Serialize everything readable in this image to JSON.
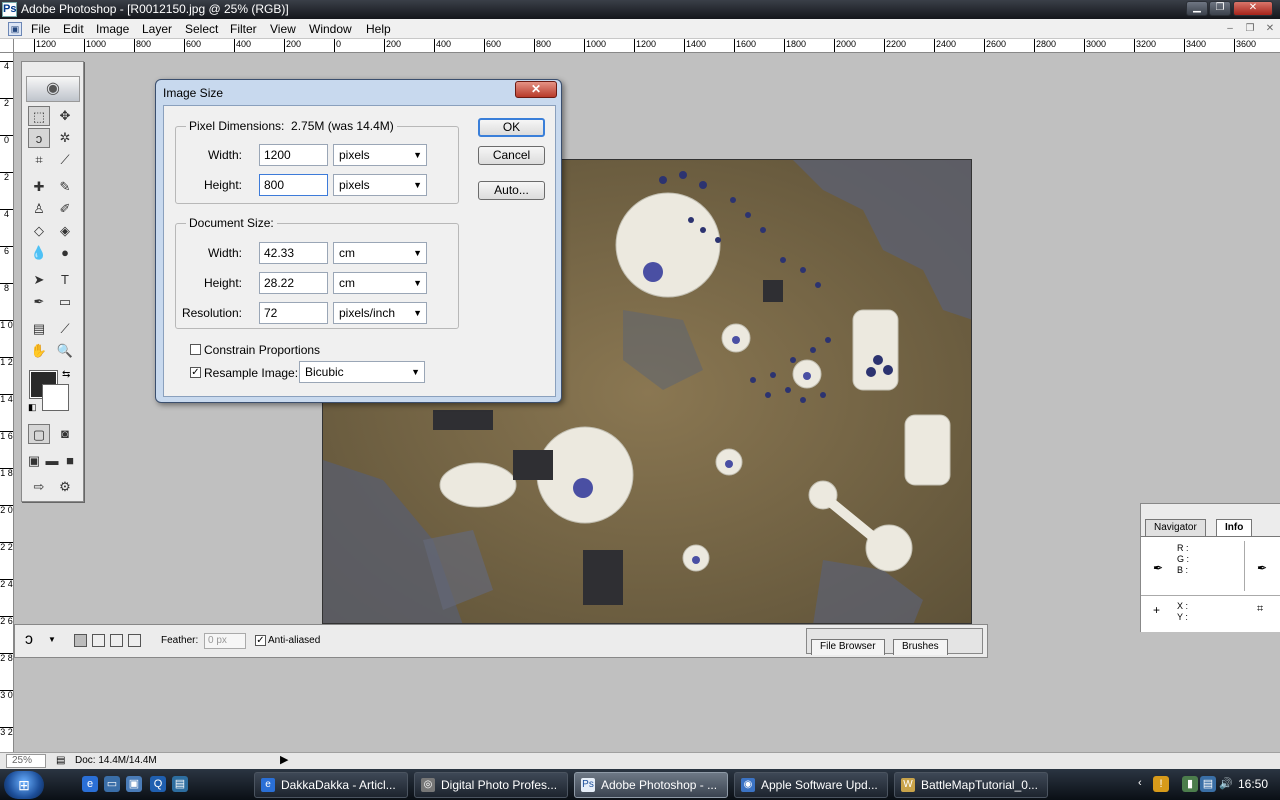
{
  "window": {
    "title": "Adobe Photoshop - [R0012150.jpg @ 25% (RGB)]",
    "controls": [
      "minimize-icon",
      "restore-icon",
      "close-icon"
    ]
  },
  "menu": {
    "items": [
      "File",
      "Edit",
      "Image",
      "Layer",
      "Select",
      "Filter",
      "View",
      "Window",
      "Help"
    ]
  },
  "ruler": {
    "h_ticks": [
      "1200",
      "1000",
      "800",
      "600",
      "400",
      "200",
      "0",
      "200",
      "400",
      "600",
      "800",
      "1000",
      "1200",
      "1400",
      "1600",
      "1800",
      "2000",
      "2200",
      "2400",
      "2600",
      "2800",
      "3000",
      "3200",
      "3400",
      "3600"
    ],
    "v_ticks": [
      "4",
      "2",
      "0",
      "2",
      "4",
      "6",
      "8",
      "1 0",
      "1 2",
      "1 4",
      "1 6",
      "1 8",
      "2 0",
      "2 2",
      "2 4",
      "2 6",
      "2 8",
      "3 0",
      "3 2"
    ]
  },
  "dialog": {
    "title": "Image Size",
    "pixel_dimensions": {
      "label": "Pixel Dimensions:",
      "size": "2.75M (was 14.4M)",
      "width_label": "Width:",
      "width_value": "1200",
      "width_unit": "pixels",
      "height_label": "Height:",
      "height_value": "800",
      "height_unit": "pixels"
    },
    "document_size": {
      "label": "Document Size:",
      "width_label": "Width:",
      "width_value": "42.33",
      "width_unit": "cm",
      "height_label": "Height:",
      "height_value": "28.22",
      "height_unit": "cm",
      "resolution_label": "Resolution:",
      "resolution_value": "72",
      "resolution_unit": "pixels/inch"
    },
    "constrain_proportions": {
      "label": "Constrain Proportions",
      "checked": false
    },
    "resample_image": {
      "label": "Resample Image:",
      "checked": true,
      "method": "Bicubic"
    },
    "buttons": {
      "ok": "OK",
      "cancel": "Cancel",
      "auto": "Auto..."
    }
  },
  "options_bar": {
    "feather_label": "Feather:",
    "feather_value": "0 px",
    "anti_aliased_label": "Anti-aliased",
    "anti_aliased_checked": true,
    "tabs": [
      "File Browser",
      "Brushes"
    ]
  },
  "info_palette": {
    "tabs": [
      "Navigator",
      "Info"
    ],
    "active_tab": "Info",
    "rgb_labels": [
      "R :",
      "G :",
      "B :"
    ],
    "xy_labels": [
      "X :",
      "Y :"
    ]
  },
  "status_bar": {
    "zoom": "25%",
    "doc_info": "Doc: 14.4M/14.4M"
  },
  "taskbar": {
    "buttons": [
      {
        "label": "DakkaDakka - Articl...",
        "icon": "ie-icon",
        "active": false
      },
      {
        "label": "Digital Photo Profes...",
        "icon": "camera-icon",
        "active": false
      },
      {
        "label": "Adobe Photoshop - ...",
        "icon": "photoshop-icon",
        "active": true
      },
      {
        "label": "Apple Software Upd...",
        "icon": "apple-update-icon",
        "active": false
      },
      {
        "label": "BattleMapTutorial_0...",
        "icon": "wordpad-icon",
        "active": false
      }
    ],
    "clock": "16:50"
  },
  "colors": {
    "accent": "#3a7fd9",
    "dialog_frame": "#c8d9ee",
    "foreground_swatch": "#2a2a2a",
    "background_swatch": "#ffffff"
  }
}
